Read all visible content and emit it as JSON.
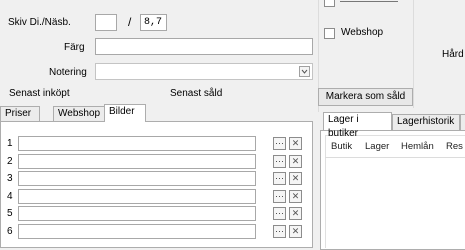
{
  "top": {
    "size_label": "Skiv Di./Näsb.",
    "size_sep": "/",
    "size_value": "8,7",
    "color_label": "Färg",
    "note_label": "Notering",
    "last_bought_label": "Senast inköpt",
    "last_sold_label": "Senast såld"
  },
  "right": {
    "webshop_label": "Webshop",
    "hard_label": "Hård",
    "mark_sold_button": "Markera som såld"
  },
  "left_tabs": [
    "Priser",
    "Webshop",
    "Bilder"
  ],
  "image_rows": [
    "1",
    "2",
    "3",
    "4",
    "5",
    "6"
  ],
  "row_button_glyphs": {
    "browse": "···",
    "remove": "✕"
  },
  "right_tabs": [
    "Lager i butiker",
    "Lagerhistorik"
  ],
  "stock_columns": [
    "Butik",
    "Lager",
    "Hemlån",
    "Res"
  ]
}
